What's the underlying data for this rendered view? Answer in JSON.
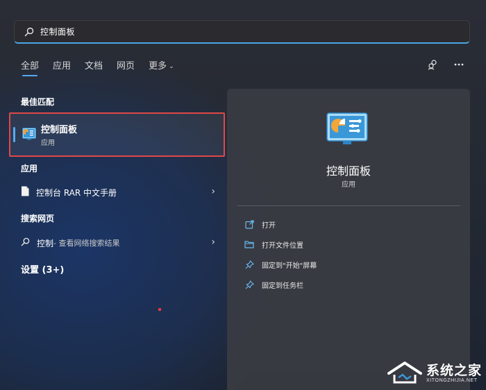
{
  "search": {
    "query": "控制面板"
  },
  "tabs": [
    {
      "label": "全部",
      "active": true
    },
    {
      "label": "应用"
    },
    {
      "label": "文档"
    },
    {
      "label": "网页"
    },
    {
      "label": "更多"
    }
  ],
  "top_icons": [
    "account-switch-icon",
    "more-options-icon"
  ],
  "best_match": {
    "heading": "最佳匹配",
    "name": "控制面板",
    "type": "应用",
    "icon": "control-panel-icon"
  },
  "apps": {
    "heading": "应用",
    "items": [
      {
        "label": "控制台 RAR 中文手册",
        "icon": "document-icon"
      }
    ]
  },
  "web_search": {
    "heading": "搜索网页",
    "query": "控制",
    "suffix": " - 查看网络搜索结果"
  },
  "settings": {
    "heading": "设置 (3+)"
  },
  "detail": {
    "title": "控制面板",
    "subtitle": "应用",
    "actions": [
      {
        "label": "打开",
        "icon": "open-external-icon"
      },
      {
        "label": "打开文件位置",
        "icon": "folder-icon"
      },
      {
        "label": "固定到\"开始\"屏幕",
        "icon": "pin-icon"
      },
      {
        "label": "固定到任务栏",
        "icon": "pin-icon"
      }
    ]
  },
  "watermark": {
    "main": "系统之家",
    "sub": "XITONGZHIJIA.NET"
  },
  "colors": {
    "accent": "#55aaf0",
    "highlight_border": "#e04848",
    "panel": "#3a3c42"
  }
}
